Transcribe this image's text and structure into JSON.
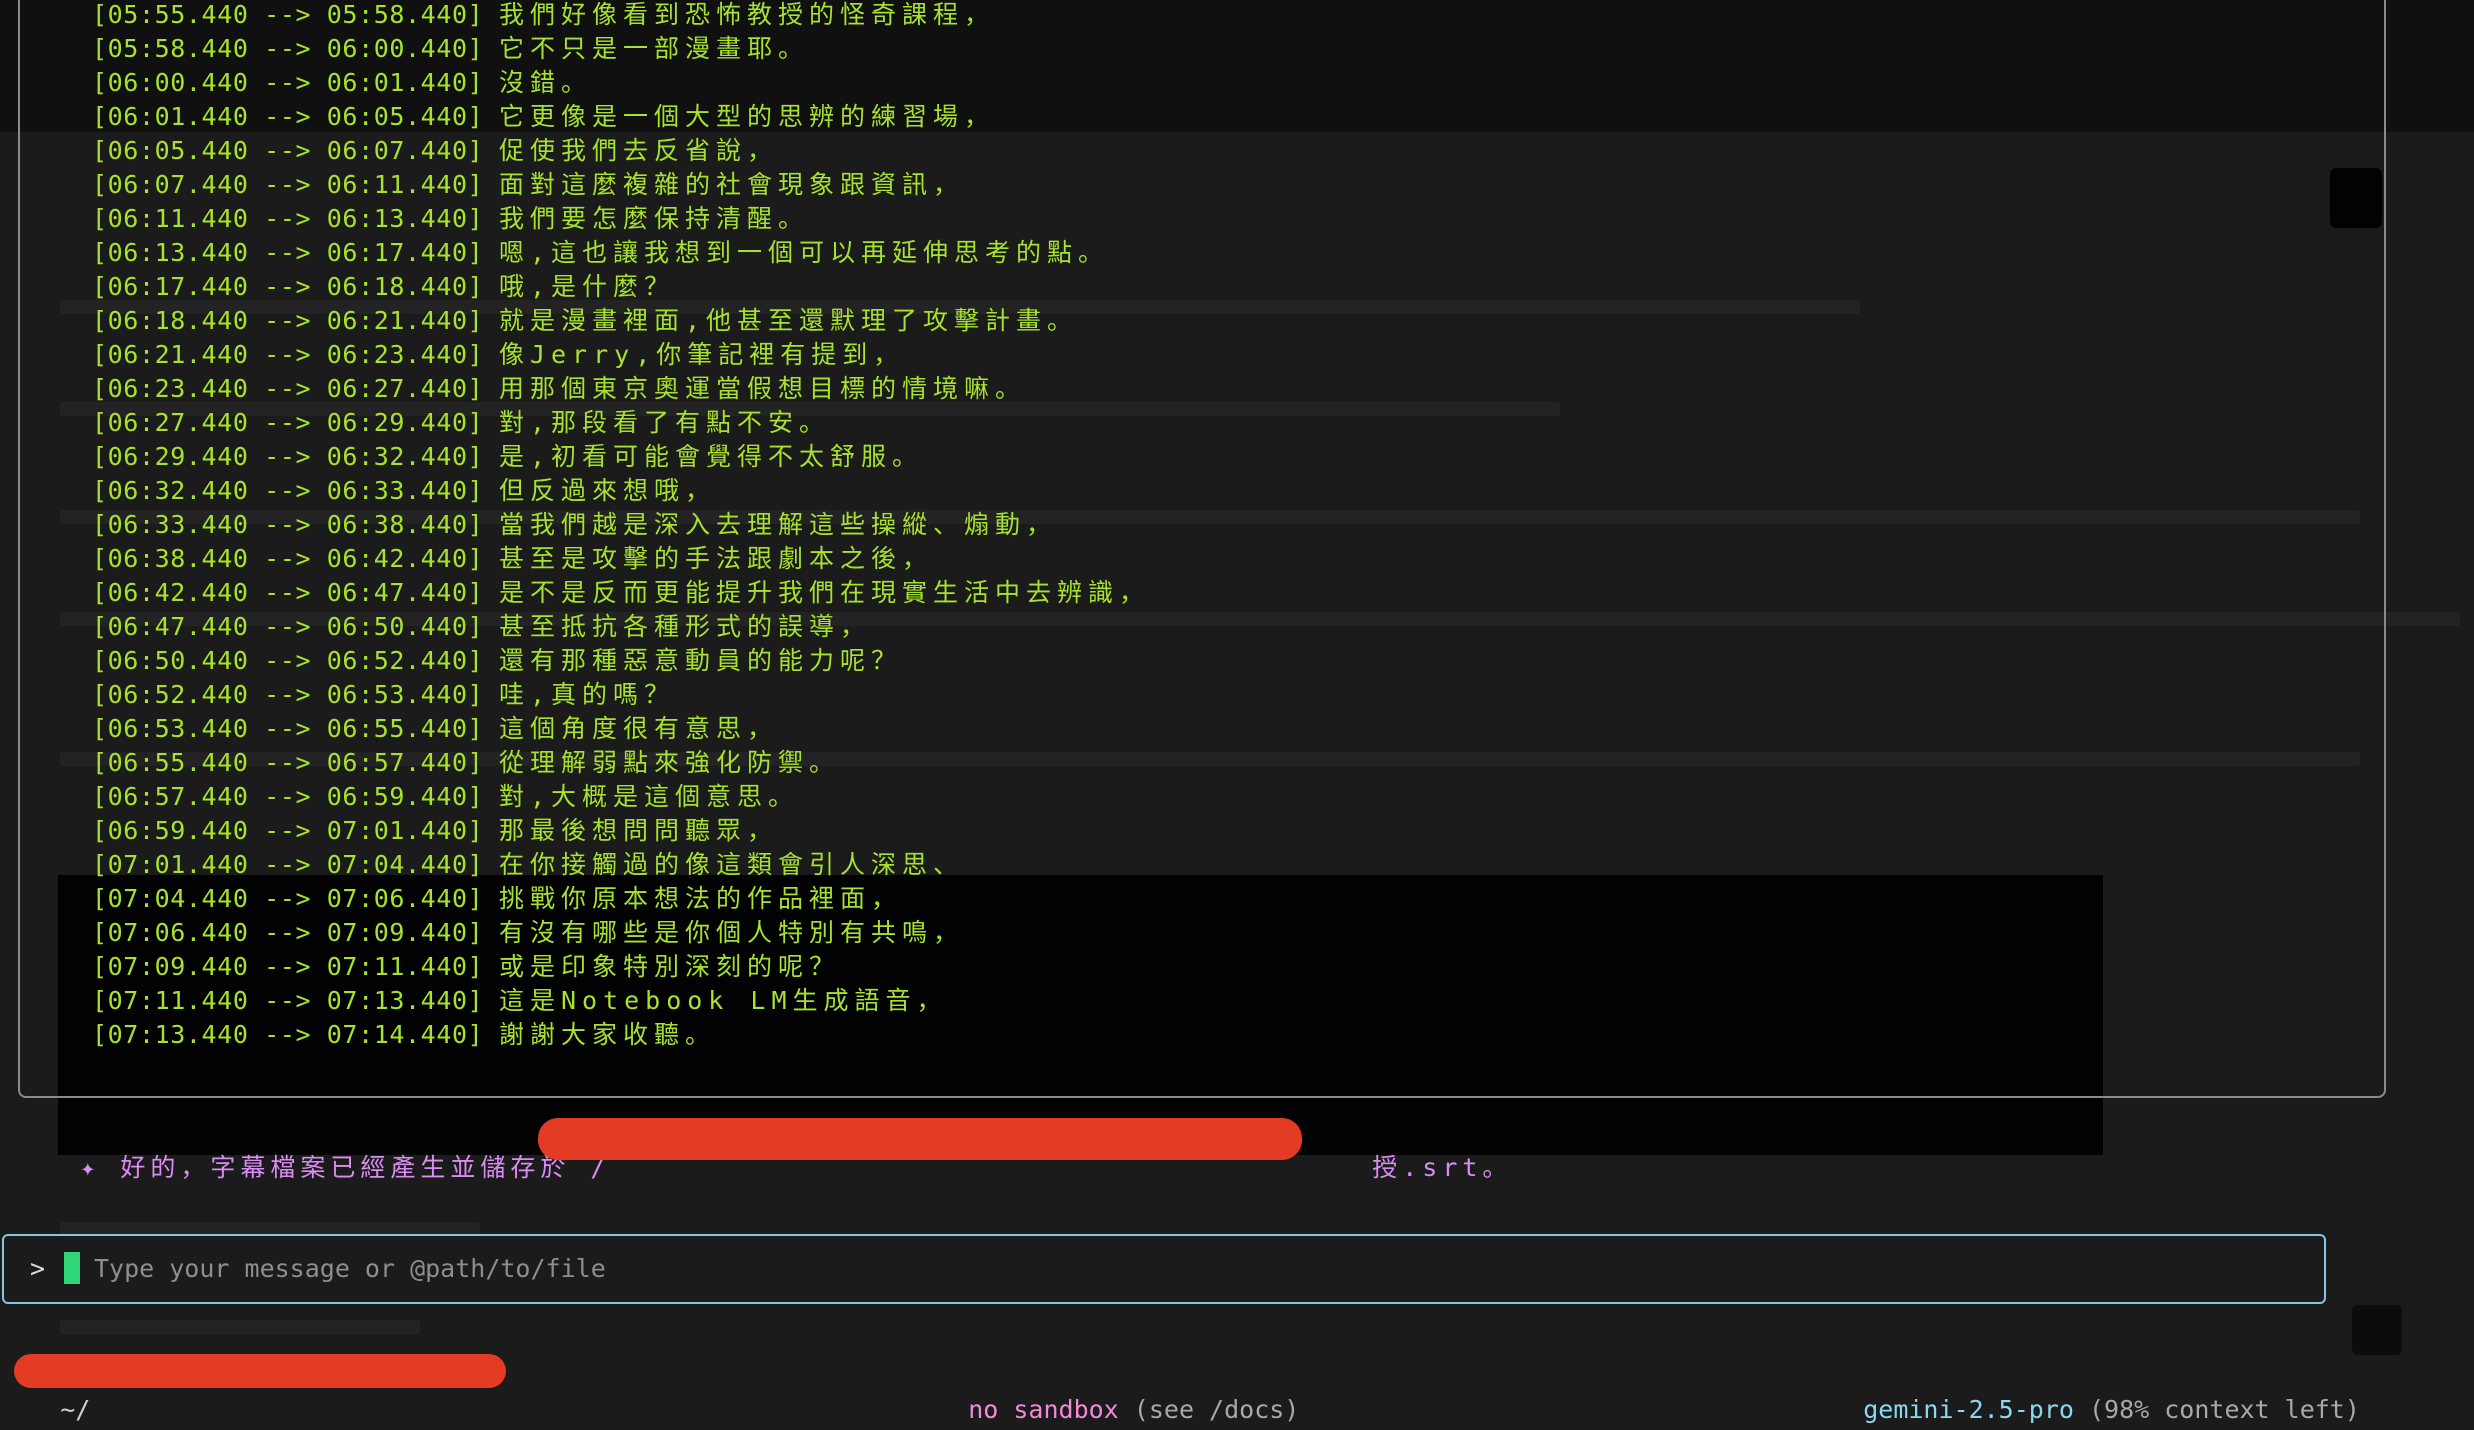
{
  "output_lines": [
    {
      "ts": "[05:55.440 --> 05:58.440]",
      "text": "我們好像看到恐怖教授的怪奇課程，"
    },
    {
      "ts": "[05:58.440 --> 06:00.440]",
      "text": "它不只是一部漫畫耶。"
    },
    {
      "ts": "[06:00.440 --> 06:01.440]",
      "text": "沒錯。"
    },
    {
      "ts": "[06:01.440 --> 06:05.440]",
      "text": "它更像是一個大型的思辨的練習場，"
    },
    {
      "ts": "[06:05.440 --> 06:07.440]",
      "text": "促使我們去反省說，"
    },
    {
      "ts": "[06:07.440 --> 06:11.440]",
      "text": "面對這麼複雜的社會現象跟資訊，"
    },
    {
      "ts": "[06:11.440 --> 06:13.440]",
      "text": "我們要怎麼保持清醒。"
    },
    {
      "ts": "[06:13.440 --> 06:17.440]",
      "text": "嗯,這也讓我想到一個可以再延伸思考的點。"
    },
    {
      "ts": "[06:17.440 --> 06:18.440]",
      "text": "哦,是什麼？"
    },
    {
      "ts": "[06:18.440 --> 06:21.440]",
      "text": "就是漫畫裡面,他甚至還默理了攻擊計畫。"
    },
    {
      "ts": "[06:21.440 --> 06:23.440]",
      "text": "像Jerry,你筆記裡有提到，"
    },
    {
      "ts": "[06:23.440 --> 06:27.440]",
      "text": "用那個東京奧運當假想目標的情境嘛。"
    },
    {
      "ts": "[06:27.440 --> 06:29.440]",
      "text": "對,那段看了有點不安。"
    },
    {
      "ts": "[06:29.440 --> 06:32.440]",
      "text": "是,初看可能會覺得不太舒服。"
    },
    {
      "ts": "[06:32.440 --> 06:33.440]",
      "text": "但反過來想哦，"
    },
    {
      "ts": "[06:33.440 --> 06:38.440]",
      "text": "當我們越是深入去理解這些操縱、煽動，"
    },
    {
      "ts": "[06:38.440 --> 06:42.440]",
      "text": "甚至是攻擊的手法跟劇本之後，"
    },
    {
      "ts": "[06:42.440 --> 06:47.440]",
      "text": "是不是反而更能提升我們在現實生活中去辨識，"
    },
    {
      "ts": "[06:47.440 --> 06:50.440]",
      "text": "甚至抵抗各種形式的誤導，"
    },
    {
      "ts": "[06:50.440 --> 06:52.440]",
      "text": "還有那種惡意動員的能力呢？"
    },
    {
      "ts": "[06:52.440 --> 06:53.440]",
      "text": "哇,真的嗎？"
    },
    {
      "ts": "[06:53.440 --> 06:55.440]",
      "text": "這個角度很有意思，"
    },
    {
      "ts": "[06:55.440 --> 06:57.440]",
      "text": "從理解弱點來強化防禦。"
    },
    {
      "ts": "[06:57.440 --> 06:59.440]",
      "text": "對,大概是這個意思。"
    },
    {
      "ts": "[06:59.440 --> 07:01.440]",
      "text": "那最後想問問聽眾，"
    },
    {
      "ts": "[07:01.440 --> 07:04.440]",
      "text": "在你接觸過的像這類會引人深思、"
    },
    {
      "ts": "[07:04.440 --> 07:06.440]",
      "text": "挑戰你原本想法的作品裡面，"
    },
    {
      "ts": "[07:06.440 --> 07:09.440]",
      "text": "有沒有哪些是你個人特別有共鳴，"
    },
    {
      "ts": "[07:09.440 --> 07:11.440]",
      "text": "或是印象特別深刻的呢？"
    },
    {
      "ts": "[07:11.440 --> 07:13.440]",
      "text": "這是Notebook LM生成語音，"
    },
    {
      "ts": "[07:13.440 --> 07:14.440]",
      "text": "謝謝大家收聽。"
    }
  ],
  "response": {
    "prefix": "✦ 好的，字幕檔案已經產生並儲存於 /",
    "suffix": "授.srt。"
  },
  "input": {
    "prompt": ">",
    "placeholder": "Type your message or @path/to/file"
  },
  "footer": {
    "path_prefix": "~/",
    "sandbox_label": "no sandbox",
    "sandbox_hint": " (see /docs)",
    "model": "gemini-2.5-pro",
    "context": " (98% context left)"
  },
  "colors": {
    "output_text": "#a6e22e",
    "response_text": "#d98cf2",
    "input_border": "#7fc8e6",
    "cursor": "#2fd67a",
    "redaction": "#e43b25",
    "sandbox": "#f08ad8",
    "model": "#8ad8f0"
  }
}
